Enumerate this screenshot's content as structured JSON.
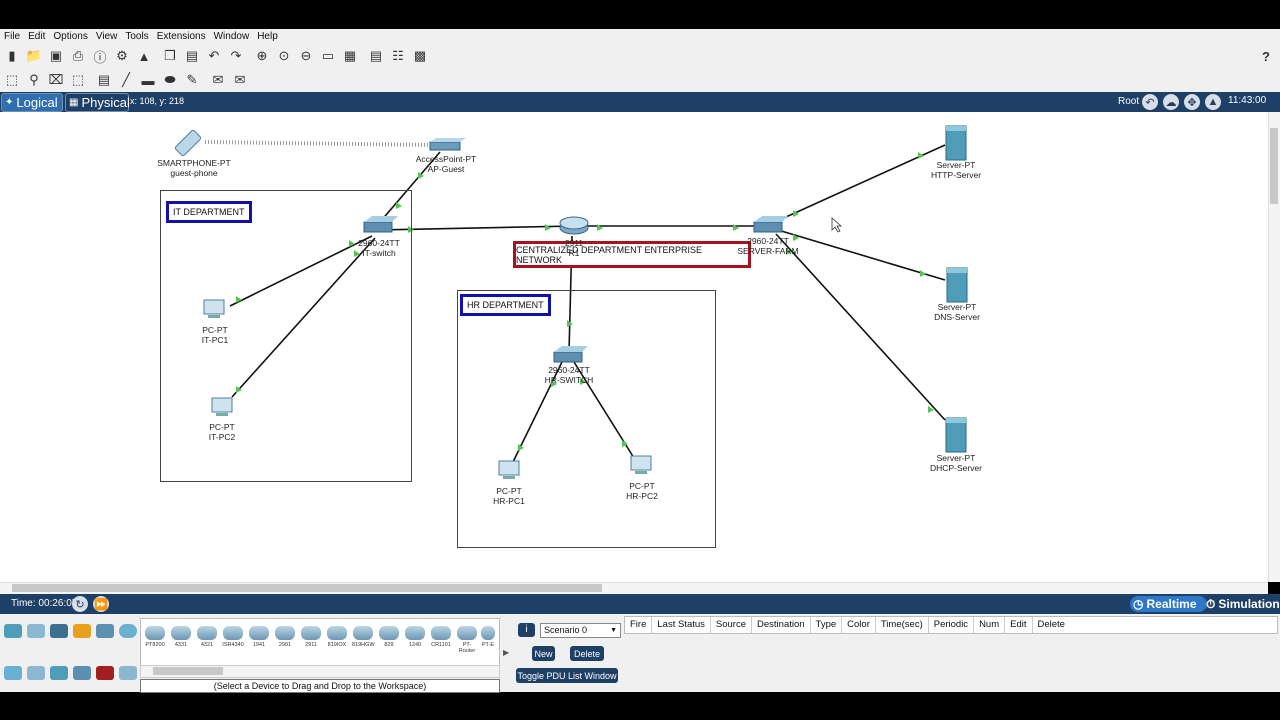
{
  "menu": [
    "File",
    "Edit",
    "Options",
    "View",
    "Tools",
    "Extensions",
    "Window",
    "Help"
  ],
  "help_icon": "?",
  "modes": {
    "logical": "Logical",
    "physical": "Physical"
  },
  "coords": "x: 108, y: 218",
  "root": "Root",
  "clock": "11:43:00",
  "network_title": "CENTRALIZED DEPARTMENT ENTERPRISE NETWORK",
  "departments": {
    "it": "IT DEPARTMENT",
    "hr": "HR DEPARTMENT"
  },
  "devices": {
    "smartphone": {
      "model": "SMARTPHONE-PT",
      "name": "guest-phone"
    },
    "ap": {
      "model": "AccessPoint-PT",
      "name": "AP-Guest"
    },
    "router": {
      "model": "2911",
      "name": "R1"
    },
    "it_switch": {
      "model": "2960-24TT",
      "name": "IT-switch"
    },
    "server_switch": {
      "model": "2960-24TT",
      "name": "SERVER-FARM"
    },
    "hr_switch": {
      "model": "2960-24TT",
      "name": "HR-SWITCH"
    },
    "it_pc1": {
      "model": "PC-PT",
      "name": "IT-PC1"
    },
    "it_pc2": {
      "model": "PC-PT",
      "name": "IT-PC2"
    },
    "hr_pc1": {
      "model": "PC-PT",
      "name": "HR-PC1"
    },
    "hr_pc2": {
      "model": "PC-PT",
      "name": "HR-PC2"
    },
    "http": {
      "model": "Server-PT",
      "name": "HTTP-Server"
    },
    "dns": {
      "model": "Server-PT",
      "name": "DNS-Server"
    },
    "dhcp": {
      "model": "Server-PT",
      "name": "DHCP-Server"
    }
  },
  "time": "Time: 00:26:05",
  "realtime": "Realtime",
  "simulation": "Simulation",
  "device_models": [
    "PT8200",
    "4331",
    "4321",
    "ISR4340",
    "1941",
    "2901",
    "2911",
    "819IOX",
    "819HGW",
    "829",
    "1240",
    "CR1101",
    "PT-Router",
    "PT-E"
  ],
  "hint": "(Select a Device to Drag and Drop to the Workspace)",
  "scenario": "Scenario 0",
  "new_label": "New",
  "delete_label": "Delete",
  "toggle_label": "Toggle PDU List Window",
  "pdu_columns": [
    "Fire",
    "Last Status",
    "Source",
    "Destination",
    "Type",
    "Color",
    "Time(sec)",
    "Periodic",
    "Num",
    "Edit",
    "Delete"
  ]
}
